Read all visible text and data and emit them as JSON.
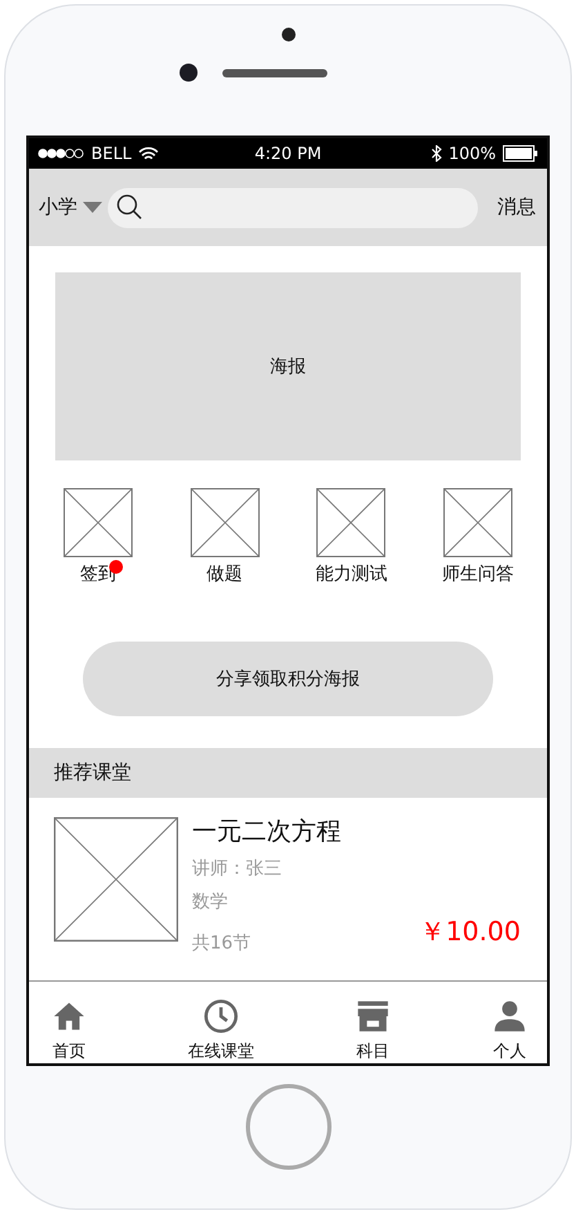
{
  "status_bar": {
    "carrier": "BELL",
    "time": "4:20 PM",
    "battery": "100%"
  },
  "header": {
    "grade": "小学",
    "message": "消息"
  },
  "poster": {
    "label": "海报"
  },
  "shortcuts": [
    {
      "label": "签到",
      "dot": true
    },
    {
      "label": "做题",
      "dot": false
    },
    {
      "label": "能力测试",
      "dot": false
    },
    {
      "label": "师生问答",
      "dot": false
    }
  ],
  "share_button": "分享领取积分海报",
  "section": {
    "title": "推荐课堂"
  },
  "courses": [
    {
      "title": "一元二次方程",
      "teacher": "讲师：张三",
      "subject": "数学",
      "lessons": "共16节",
      "price": "￥10.00"
    }
  ],
  "tabs": [
    {
      "label": "首页",
      "selected": false
    },
    {
      "label": "在线课堂",
      "selected": false
    },
    {
      "label": "科目",
      "selected": false
    },
    {
      "label": "个人",
      "selected": false
    }
  ]
}
